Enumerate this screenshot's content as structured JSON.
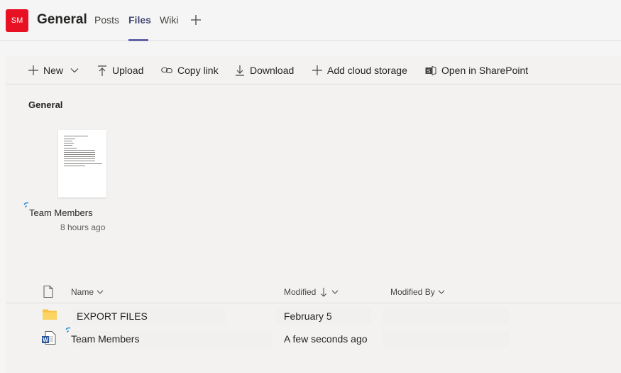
{
  "header": {
    "avatar_initials": "SM",
    "avatar_color": "#e81123",
    "channel_title": "General",
    "tabs": [
      {
        "label": "Posts",
        "active": false
      },
      {
        "label": "Files",
        "active": true
      },
      {
        "label": "Wiki",
        "active": false
      }
    ],
    "add_tab_icon": "plus-icon",
    "accent_color": "#6264a7"
  },
  "toolbar": {
    "items": [
      {
        "label": "New",
        "icon": "plus-icon",
        "has_dropdown": true
      },
      {
        "label": "Upload",
        "icon": "upload-arrow-icon"
      },
      {
        "label": "Copy link",
        "icon": "link-icon"
      },
      {
        "label": "Download",
        "icon": "download-arrow-icon"
      },
      {
        "label": "Add cloud storage",
        "icon": "plus-icon"
      },
      {
        "label": "Open in SharePoint",
        "icon": "sharepoint-icon"
      }
    ]
  },
  "section": {
    "title": "General",
    "recent_tile": {
      "name": "Team Members",
      "time": "8 hours ago"
    }
  },
  "file_list": {
    "columns": [
      {
        "label": "Name",
        "sort": "none"
      },
      {
        "label": "Modified",
        "sort": "descending"
      },
      {
        "label": "Modified By",
        "sort": "none"
      }
    ],
    "rows": [
      {
        "type": "folder",
        "icon": "folder-icon",
        "name": "EXPORT FILES",
        "modified": "February 5"
      },
      {
        "type": "word",
        "icon": "word-doc-icon",
        "name": "Team Members",
        "modified": "A few seconds ago"
      }
    ]
  }
}
